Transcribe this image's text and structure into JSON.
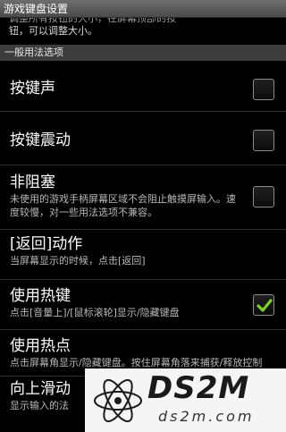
{
  "window": {
    "title": "游戏键盘设置"
  },
  "partial_text": {
    "line1": "调整所有按钮的大小，在屏幕顶部的按",
    "line2": "钮，可以调整大小。"
  },
  "section": {
    "header": "一般用法选项"
  },
  "items": [
    {
      "title": "按键声",
      "summary": "",
      "checked": false
    },
    {
      "title": "按键震动",
      "summary": "",
      "checked": false
    },
    {
      "title": "非阻塞",
      "summary": "未使用的游戏手柄屏幕区域不会阻止触摸屏输入。速度较慢，对一些用法选项不兼容。",
      "checked": false
    },
    {
      "title": "[返回]动作",
      "summary": "当屏幕显示的时候，点击[返回]"
    },
    {
      "title": "使用热键",
      "summary": "点击[音量上]/[鼠标滚轮]显示/隐藏键盘",
      "checked": true
    },
    {
      "title": "使用热点",
      "summary": "点击屏幕角显示/隐藏键盘。按住屏幕角落来捕获/释放控制"
    },
    {
      "title": "向上滑动",
      "summary": "显示输入的法"
    }
  ],
  "watermark": {
    "brand": "DS2M",
    "domain": "ds2m.com"
  },
  "colors": {
    "check": "#7fd12a",
    "section_bg": "#3d3d3d"
  }
}
